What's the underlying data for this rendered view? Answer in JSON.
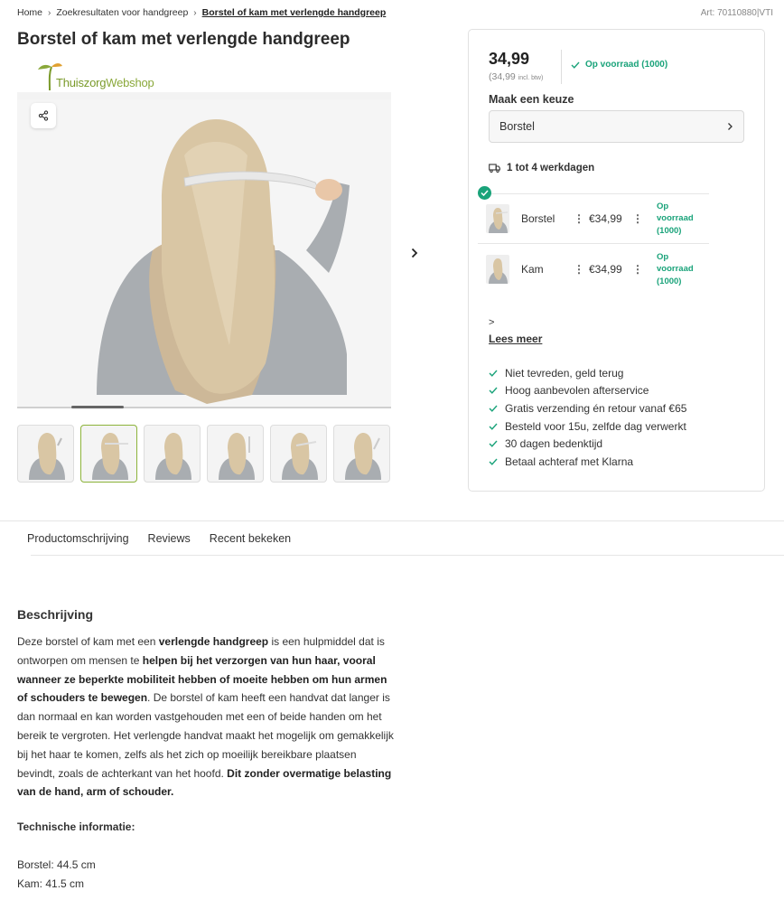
{
  "breadcrumb": {
    "items": [
      "Home",
      "Zoekresultaten voor handgreep",
      "Borstel of kam met verlengde handgreep"
    ]
  },
  "article_number": "Art: 70110880|VTI",
  "product": {
    "title": "Borstel of kam met verlengde handgreep",
    "logo_text_1": "Thuiszorg",
    "logo_text_2": "Webshop"
  },
  "purchase": {
    "price": "34,99",
    "price_sub": "(34,99",
    "price_sub_small": "incl. btw)",
    "stock": "Op voorraad (1000)",
    "choice_label": "Maak een keuze",
    "selected_option": "Borstel",
    "delivery": "1 tot 4 werkdagen",
    "variants": [
      {
        "name": "Borstel",
        "price": "€34,99",
        "stock_1": "Op",
        "stock_2": "voorraad",
        "stock_3": "(1000)"
      },
      {
        "name": "Kam",
        "price": "€34,99",
        "stock_1": "Op",
        "stock_2": "voorraad",
        "stock_3": "(1000)"
      }
    ],
    "more_arrow": ">",
    "more_link": "Lees meer",
    "usps": [
      "Niet tevreden, geld terug",
      "Hoog aanbevolen afterservice",
      "Gratis verzending én retour vanaf €65",
      "Besteld voor 15u, zelfde dag verwerkt",
      "30 dagen bedenktijd",
      "Betaal achteraf met Klarna"
    ]
  },
  "tabs": [
    "Productomschrijving",
    "Reviews",
    "Recent bekeken"
  ],
  "description": {
    "title": "Beschrijving",
    "p1": "Deze borstel of kam met een ",
    "p1b": "verlengde handgreep",
    "p2": " is een hulpmiddel dat is ontworpen om mensen te ",
    "p2b": "helpen bij het verzorgen van hun haar, vooral wanneer ze beperkte mobiliteit hebben of moeite hebben om hun armen of schouders te bewegen",
    "p3": ". De borstel of kam heeft een handvat dat langer is dan normaal en kan worden vastgehouden met een of beide handen om het bereik te vergroten. Het verlengde handvat maakt het mogelijk om gemakkelijk bij het haar te komen, zelfs als het zich op moeilijk bereikbare plaatsen bevindt, zoals de achterkant van het hoofd. ",
    "p3b": "Dit zonder overmatige belasting van de hand, arm of schouder.",
    "tech_title": "Technische informatie:",
    "dim_brush": "Borstel: 44.5 cm",
    "dim_comb": "Kam: 41.5 cm"
  },
  "colors": {
    "accent_green": "#1aa37a",
    "thumb_active": "#8cb33a"
  }
}
